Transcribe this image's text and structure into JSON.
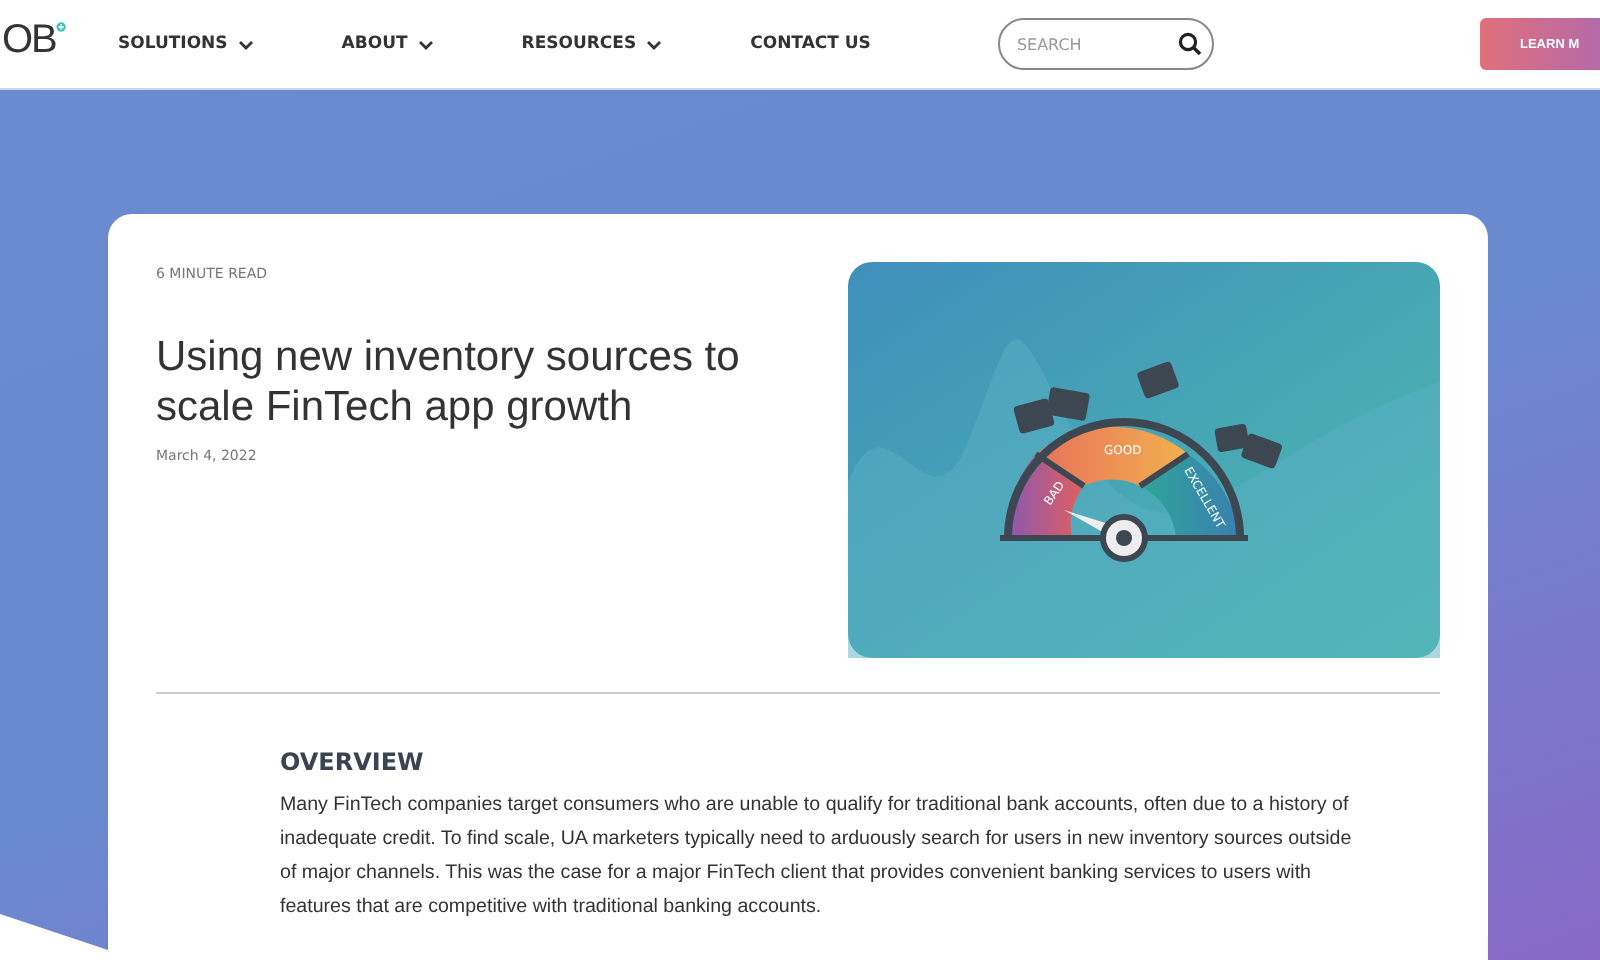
{
  "header": {
    "logo": "OB",
    "nav": [
      {
        "label": "SOLUTIONS",
        "dropdown": true
      },
      {
        "label": "ABOUT",
        "dropdown": true
      },
      {
        "label": "RESOURCES",
        "dropdown": true
      },
      {
        "label": "CONTACT US",
        "dropdown": false
      }
    ],
    "search": {
      "placeholder": "SEARCH"
    },
    "cta": "LEARN M"
  },
  "article": {
    "read_time": "6 MINUTE READ",
    "title": "Using new inventory sources to scale FinTech app growth",
    "date": "March 4, 2022",
    "illustration": {
      "gauge_labels": [
        "BAD",
        "GOOD",
        "EXCELLENT"
      ]
    },
    "sections": [
      {
        "heading": "OVERVIEW",
        "body": "Many FinTech companies target consumers who are unable to qualify for traditional bank accounts, often due to a history of inadequate credit. To find scale, UA marketers typically need to arduously search for users in new inventory sources outside of major channels. This was the case for a major FinTech client that provides convenient banking services to users with features that are competitive with traditional banking accounts."
      }
    ]
  }
}
